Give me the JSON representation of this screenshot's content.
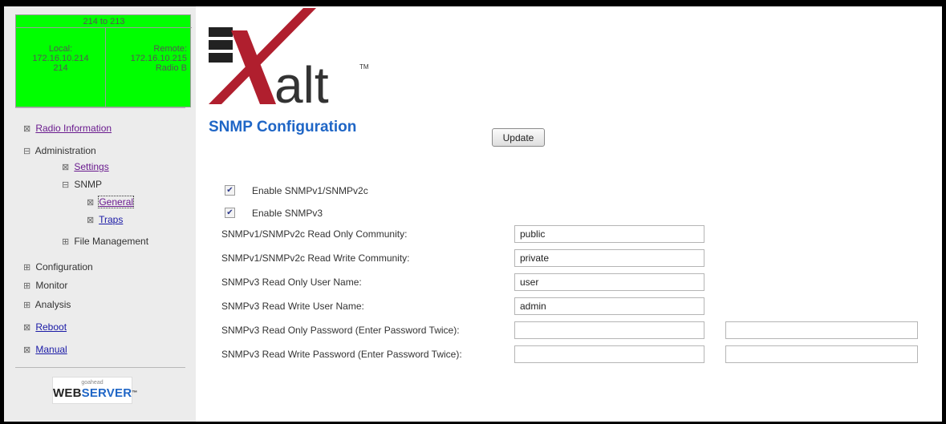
{
  "status": {
    "title": "214 to 213",
    "local": {
      "label": "Local:",
      "ip": "172.16.10.214",
      "name": "214"
    },
    "remote": {
      "label": "Remote:",
      "ip": "172.16.10.215",
      "name": "Radio B"
    }
  },
  "nav": {
    "radio_information": "Radio Information",
    "administration": "Administration",
    "settings": "Settings",
    "snmp": "SNMP",
    "general": "General",
    "traps": "Traps",
    "file_management": "File Management",
    "configuration": "Configuration",
    "monitor": "Monitor",
    "analysis": "Analysis",
    "reboot": "Reboot",
    "manual": "Manual",
    "glyph_collapsed": "⊞",
    "glyph_expanded": "⊟",
    "glyph_leaf": "⊠"
  },
  "webserver": {
    "small": "goahead",
    "web": "WEB",
    "server": "SERVER",
    "tm": "™"
  },
  "logo": {
    "text": "alt",
    "tm": "TM"
  },
  "page": {
    "title": "SNMP Configuration",
    "update_label": "Update"
  },
  "checks": [
    {
      "label": "Enable SNMPv1/SNMPv2c",
      "checked": true,
      "mark": "✔"
    },
    {
      "label": "Enable SNMPv3",
      "checked": true,
      "mark": "✔"
    }
  ],
  "fields": [
    {
      "label": "SNMPv1/SNMPv2c Read Only Community:",
      "value": "public"
    },
    {
      "label": "SNMPv1/SNMPv2c Read Write Community:",
      "value": "private"
    },
    {
      "label": "SNMPv3 Read Only User Name:",
      "value": "user"
    },
    {
      "label": "SNMPv3 Read Write User Name:",
      "value": "admin"
    },
    {
      "label": "SNMPv3 Read Only Password (Enter Password Twice):",
      "value": "",
      "value2": ""
    },
    {
      "label": "SNMPv3 Read Write Password (Enter Password Twice):",
      "value": "",
      "value2": ""
    }
  ],
  "colors": {
    "status_green": "#00ff00",
    "title_blue": "#1f66c6",
    "logo_red": "#b01f2e",
    "link_blue": "#1a1aa6",
    "link_visited": "#6a1b8e"
  }
}
